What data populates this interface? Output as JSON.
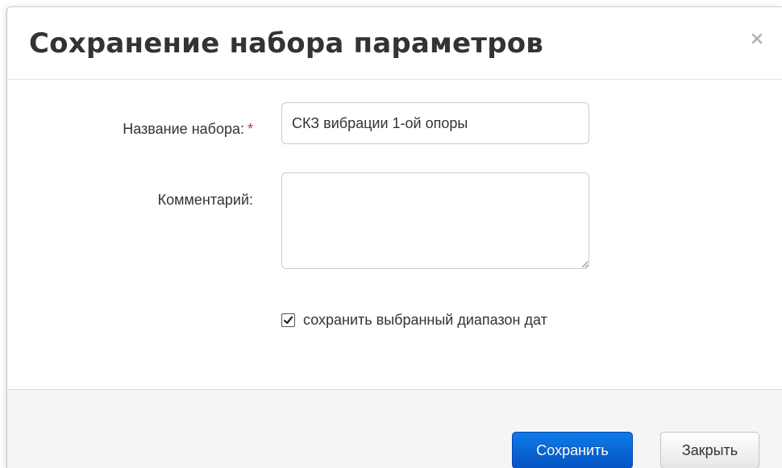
{
  "dialog": {
    "title": "Сохранение набора параметров",
    "close_icon": "close-icon"
  },
  "form": {
    "name_label": "Название набора:",
    "required_mark": "*",
    "name_value": "СКЗ вибрации 1-ой опоры",
    "comment_label": "Комментарий:",
    "comment_value": "",
    "save_range_label": "сохранить выбранный диапазон дат",
    "save_range_checked": true
  },
  "footer": {
    "save_label": "Сохранить",
    "close_label": "Закрыть"
  },
  "colors": {
    "primary": "#0a67d6",
    "required": "#cc3333",
    "footer_bg": "#f5f5f5"
  }
}
